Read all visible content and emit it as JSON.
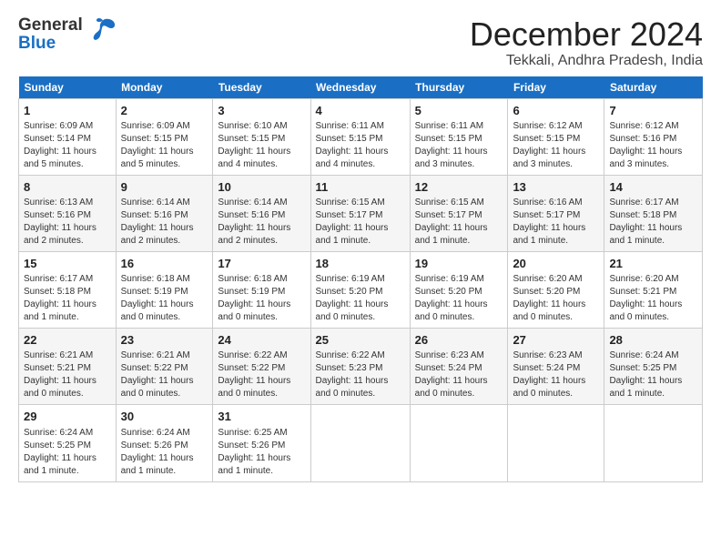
{
  "logo": {
    "line1": "General",
    "line2": "Blue"
  },
  "title": "December 2024",
  "subtitle": "Tekkali, Andhra Pradesh, India",
  "days_header": [
    "Sunday",
    "Monday",
    "Tuesday",
    "Wednesday",
    "Thursday",
    "Friday",
    "Saturday"
  ],
  "weeks": [
    [
      {
        "day": "1",
        "lines": [
          "Sunrise: 6:09 AM",
          "Sunset: 5:14 PM",
          "Daylight: 11 hours",
          "and 5 minutes."
        ]
      },
      {
        "day": "2",
        "lines": [
          "Sunrise: 6:09 AM",
          "Sunset: 5:15 PM",
          "Daylight: 11 hours",
          "and 5 minutes."
        ]
      },
      {
        "day": "3",
        "lines": [
          "Sunrise: 6:10 AM",
          "Sunset: 5:15 PM",
          "Daylight: 11 hours",
          "and 4 minutes."
        ]
      },
      {
        "day": "4",
        "lines": [
          "Sunrise: 6:11 AM",
          "Sunset: 5:15 PM",
          "Daylight: 11 hours",
          "and 4 minutes."
        ]
      },
      {
        "day": "5",
        "lines": [
          "Sunrise: 6:11 AM",
          "Sunset: 5:15 PM",
          "Daylight: 11 hours",
          "and 3 minutes."
        ]
      },
      {
        "day": "6",
        "lines": [
          "Sunrise: 6:12 AM",
          "Sunset: 5:15 PM",
          "Daylight: 11 hours",
          "and 3 minutes."
        ]
      },
      {
        "day": "7",
        "lines": [
          "Sunrise: 6:12 AM",
          "Sunset: 5:16 PM",
          "Daylight: 11 hours",
          "and 3 minutes."
        ]
      }
    ],
    [
      {
        "day": "8",
        "lines": [
          "Sunrise: 6:13 AM",
          "Sunset: 5:16 PM",
          "Daylight: 11 hours",
          "and 2 minutes."
        ]
      },
      {
        "day": "9",
        "lines": [
          "Sunrise: 6:14 AM",
          "Sunset: 5:16 PM",
          "Daylight: 11 hours",
          "and 2 minutes."
        ]
      },
      {
        "day": "10",
        "lines": [
          "Sunrise: 6:14 AM",
          "Sunset: 5:16 PM",
          "Daylight: 11 hours",
          "and 2 minutes."
        ]
      },
      {
        "day": "11",
        "lines": [
          "Sunrise: 6:15 AM",
          "Sunset: 5:17 PM",
          "Daylight: 11 hours",
          "and 1 minute."
        ]
      },
      {
        "day": "12",
        "lines": [
          "Sunrise: 6:15 AM",
          "Sunset: 5:17 PM",
          "Daylight: 11 hours",
          "and 1 minute."
        ]
      },
      {
        "day": "13",
        "lines": [
          "Sunrise: 6:16 AM",
          "Sunset: 5:17 PM",
          "Daylight: 11 hours",
          "and 1 minute."
        ]
      },
      {
        "day": "14",
        "lines": [
          "Sunrise: 6:17 AM",
          "Sunset: 5:18 PM",
          "Daylight: 11 hours",
          "and 1 minute."
        ]
      }
    ],
    [
      {
        "day": "15",
        "lines": [
          "Sunrise: 6:17 AM",
          "Sunset: 5:18 PM",
          "Daylight: 11 hours",
          "and 1 minute."
        ]
      },
      {
        "day": "16",
        "lines": [
          "Sunrise: 6:18 AM",
          "Sunset: 5:19 PM",
          "Daylight: 11 hours",
          "and 0 minutes."
        ]
      },
      {
        "day": "17",
        "lines": [
          "Sunrise: 6:18 AM",
          "Sunset: 5:19 PM",
          "Daylight: 11 hours",
          "and 0 minutes."
        ]
      },
      {
        "day": "18",
        "lines": [
          "Sunrise: 6:19 AM",
          "Sunset: 5:20 PM",
          "Daylight: 11 hours",
          "and 0 minutes."
        ]
      },
      {
        "day": "19",
        "lines": [
          "Sunrise: 6:19 AM",
          "Sunset: 5:20 PM",
          "Daylight: 11 hours",
          "and 0 minutes."
        ]
      },
      {
        "day": "20",
        "lines": [
          "Sunrise: 6:20 AM",
          "Sunset: 5:20 PM",
          "Daylight: 11 hours",
          "and 0 minutes."
        ]
      },
      {
        "day": "21",
        "lines": [
          "Sunrise: 6:20 AM",
          "Sunset: 5:21 PM",
          "Daylight: 11 hours",
          "and 0 minutes."
        ]
      }
    ],
    [
      {
        "day": "22",
        "lines": [
          "Sunrise: 6:21 AM",
          "Sunset: 5:21 PM",
          "Daylight: 11 hours",
          "and 0 minutes."
        ]
      },
      {
        "day": "23",
        "lines": [
          "Sunrise: 6:21 AM",
          "Sunset: 5:22 PM",
          "Daylight: 11 hours",
          "and 0 minutes."
        ]
      },
      {
        "day": "24",
        "lines": [
          "Sunrise: 6:22 AM",
          "Sunset: 5:22 PM",
          "Daylight: 11 hours",
          "and 0 minutes."
        ]
      },
      {
        "day": "25",
        "lines": [
          "Sunrise: 6:22 AM",
          "Sunset: 5:23 PM",
          "Daylight: 11 hours",
          "and 0 minutes."
        ]
      },
      {
        "day": "26",
        "lines": [
          "Sunrise: 6:23 AM",
          "Sunset: 5:24 PM",
          "Daylight: 11 hours",
          "and 0 minutes."
        ]
      },
      {
        "day": "27",
        "lines": [
          "Sunrise: 6:23 AM",
          "Sunset: 5:24 PM",
          "Daylight: 11 hours",
          "and 0 minutes."
        ]
      },
      {
        "day": "28",
        "lines": [
          "Sunrise: 6:24 AM",
          "Sunset: 5:25 PM",
          "Daylight: 11 hours",
          "and 1 minute."
        ]
      }
    ],
    [
      {
        "day": "29",
        "lines": [
          "Sunrise: 6:24 AM",
          "Sunset: 5:25 PM",
          "Daylight: 11 hours",
          "and 1 minute."
        ]
      },
      {
        "day": "30",
        "lines": [
          "Sunrise: 6:24 AM",
          "Sunset: 5:26 PM",
          "Daylight: 11 hours",
          "and 1 minute."
        ]
      },
      {
        "day": "31",
        "lines": [
          "Sunrise: 6:25 AM",
          "Sunset: 5:26 PM",
          "Daylight: 11 hours",
          "and 1 minute."
        ]
      },
      null,
      null,
      null,
      null
    ]
  ]
}
